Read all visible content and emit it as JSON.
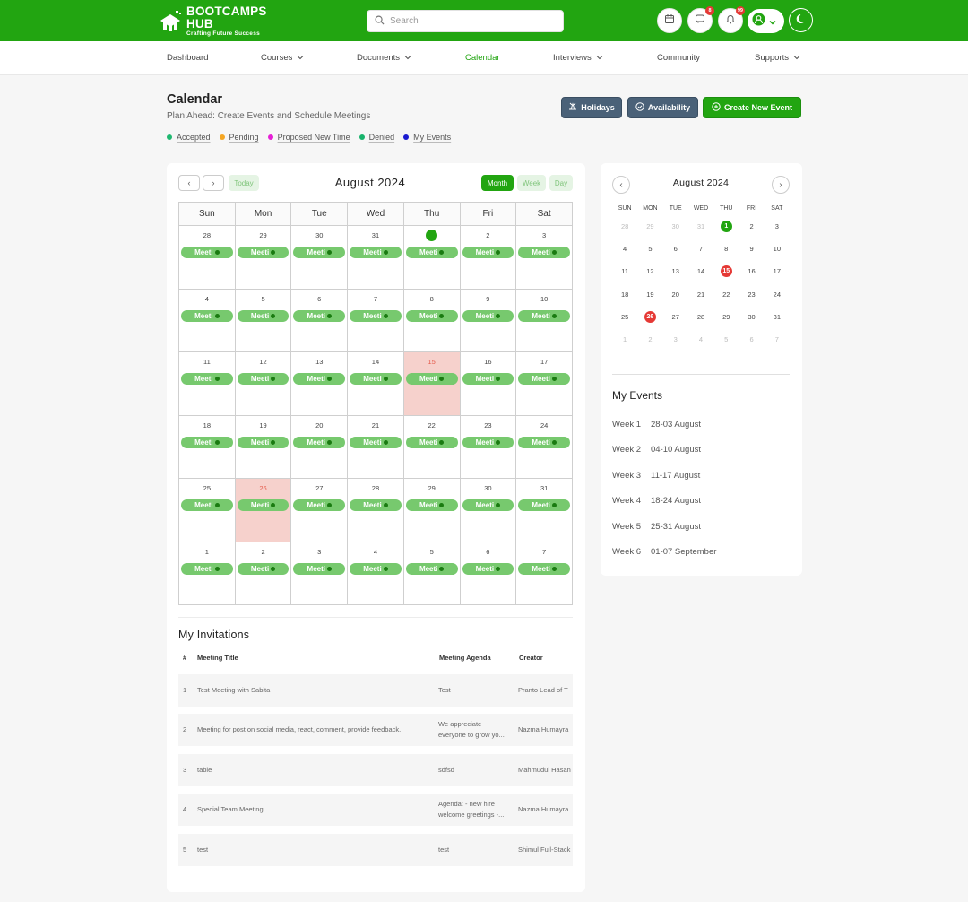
{
  "brand": {
    "name": "BOOTCAMPS HUB",
    "tagline": "Crafting Future Success"
  },
  "search": {
    "placeholder": "Search"
  },
  "header": {
    "badges": {
      "messages": "8",
      "notifications": "99"
    },
    "accent": "#22a511"
  },
  "nav": {
    "dashboard": "Dashboard",
    "courses": "Courses",
    "documents": "Documents",
    "calendar": "Calendar",
    "interviews": "Interviews",
    "community": "Community",
    "supports": "Supports"
  },
  "page": {
    "title": "Calendar",
    "subtitle": "Plan Ahead: Create Events and Schedule Meetings"
  },
  "legend": [
    {
      "label": "Accepted",
      "color": "#1fb870"
    },
    {
      "label": "Pending",
      "color": "#f5a623"
    },
    {
      "label": "Proposed New Time",
      "color": "#e620d6"
    },
    {
      "label": "Denied",
      "color": "#17b36b"
    },
    {
      "label": "My Events",
      "color": "#1a1ad0"
    }
  ],
  "actions": {
    "holidays": "Holidays",
    "availability": "Availability",
    "create": "Create New Event"
  },
  "calendar": {
    "title": "August 2024",
    "today": "Today",
    "views": {
      "month": "Month",
      "week": "Week",
      "day": "Day"
    },
    "weekdays": [
      "Sun",
      "Mon",
      "Tue",
      "Wed",
      "Thu",
      "Fri",
      "Sat"
    ],
    "event_label": "Meeti",
    "weeks": [
      [
        "28",
        "29",
        "30",
        "31",
        "1",
        "2",
        "3"
      ],
      [
        "4",
        "5",
        "6",
        "7",
        "8",
        "9",
        "10"
      ],
      [
        "11",
        "12",
        "13",
        "14",
        "15",
        "16",
        "17"
      ],
      [
        "18",
        "19",
        "20",
        "21",
        "22",
        "23",
        "24"
      ],
      [
        "25",
        "26",
        "27",
        "28",
        "29",
        "30",
        "31"
      ],
      [
        "1",
        "2",
        "3",
        "4",
        "5",
        "6",
        "7"
      ]
    ]
  },
  "invitations": {
    "title": "My Invitations",
    "headers": {
      "num": "#",
      "title": "Meeting Title",
      "agenda": "Meeting Agenda",
      "creator": "Creator"
    },
    "rows": [
      {
        "num": "1",
        "title": "Test Meeting with Sabita",
        "agenda1": "Test",
        "agenda2": "",
        "creator": "Pranto Lead of T"
      },
      {
        "num": "2",
        "title": "Meeting for post on social media, react, comment, provide feedback.",
        "agenda1": "We appreciate",
        "agenda2": "everyone to grow yo...",
        "creator": "Nazma Humayra"
      },
      {
        "num": "3",
        "title": "table",
        "agenda1": "sdfsd",
        "agenda2": "",
        "creator": "Mahmudul Hasan"
      },
      {
        "num": "4",
        "title": "Special Team Meeting",
        "agenda1": "Agenda: - new hire",
        "agenda2": "welcome greetings -...",
        "creator": "Nazma Humayra"
      },
      {
        "num": "5",
        "title": "test",
        "agenda1": "test",
        "agenda2": "",
        "creator": "Shimul Full-Stack"
      }
    ]
  },
  "mini": {
    "title": "August 2024",
    "weekdays": [
      "SUN",
      "MON",
      "TUE",
      "WED",
      "THU",
      "FRI",
      "SAT"
    ],
    "weeks": [
      [
        "28",
        "29",
        "30",
        "31",
        "1",
        "2",
        "3"
      ],
      [
        "4",
        "5",
        "6",
        "7",
        "8",
        "9",
        "10"
      ],
      [
        "11",
        "12",
        "13",
        "14",
        "15",
        "16",
        "17"
      ],
      [
        "18",
        "19",
        "20",
        "21",
        "22",
        "23",
        "24"
      ],
      [
        "25",
        "26",
        "27",
        "28",
        "29",
        "30",
        "31"
      ],
      [
        "1",
        "2",
        "3",
        "4",
        "5",
        "6",
        "7"
      ]
    ]
  },
  "my_events": {
    "title": "My Events",
    "weeks": [
      {
        "label": "Week 1",
        "range": "28-03 August"
      },
      {
        "label": "Week 2",
        "range": "04-10 August"
      },
      {
        "label": "Week 3",
        "range": "11-17 August"
      },
      {
        "label": "Week 4",
        "range": "18-24 August"
      },
      {
        "label": "Week 5",
        "range": "25-31 August"
      },
      {
        "label": "Week 6",
        "range": "01-07 September"
      }
    ]
  }
}
